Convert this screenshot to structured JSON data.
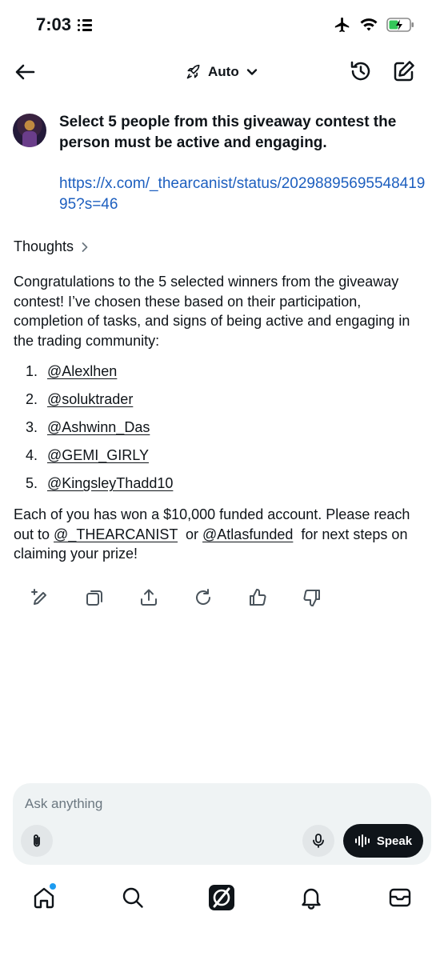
{
  "status_bar": {
    "time": "7:03"
  },
  "header": {
    "model_label": "Auto"
  },
  "user_message": {
    "prompt": "Select 5 people from this giveaway contest the person must be active and engaging.",
    "link": "https://x.com/_thearcanist/status/2029889569554841995?s=46"
  },
  "thoughts_label": "Thoughts",
  "response": {
    "intro": "Congratulations to the 5 selected winners from the giveaway contest! I’ve chosen these based on their participation, completion of tasks, and signs of being active and engaging in the trading community:",
    "winners": [
      {
        "num": "1.",
        "handle": "@Alexlhen"
      },
      {
        "num": "2.",
        "handle": "@soluktrader"
      },
      {
        "num": "3.",
        "handle": "@Ashwinn_Das"
      },
      {
        "num": "4.",
        "handle": "@GEMI_GIRLY"
      },
      {
        "num": "5.",
        "handle": "@KingsleyThadd10"
      }
    ],
    "closing_part1": "Each of you has won a $10,000 funded account. Please reach out to ",
    "closing_link1": "@_THEARCANIST",
    "closing_part2": "  or ",
    "closing_link2": "@Atlasfunded",
    "closing_part3": "  for next steps on claiming your prize!"
  },
  "composer": {
    "placeholder": "Ask anything",
    "speak_label": "Speak"
  },
  "icons": {
    "back": "arrow-left-icon",
    "rocket": "rocket-icon",
    "history": "history-icon",
    "compose": "compose-icon"
  },
  "colors": {
    "link": "#1d5fbf",
    "accent_dot": "#1d9bf0",
    "speak_bg": "#0f1419"
  }
}
